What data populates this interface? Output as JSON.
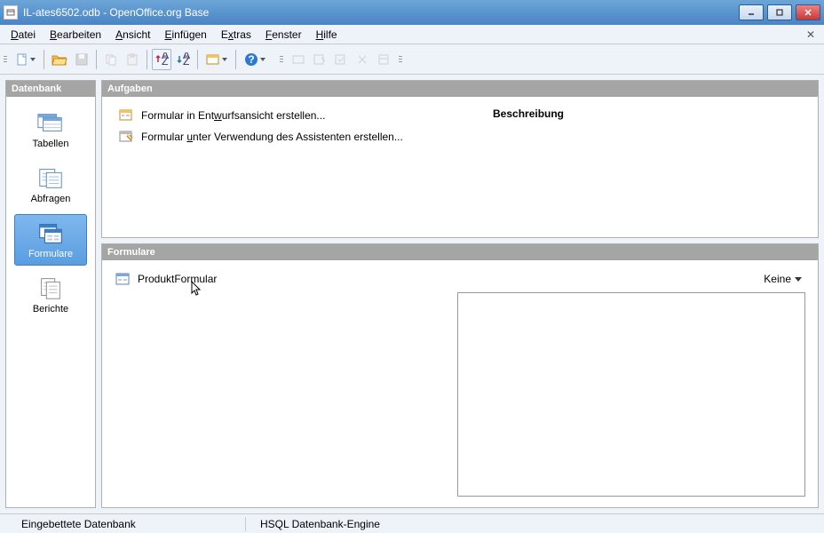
{
  "window": {
    "title": "IL-ates6502.odb - OpenOffice.org Base"
  },
  "menus": {
    "file": "Datei",
    "edit": "Bearbeiten",
    "view": "Ansicht",
    "insert": "Einfügen",
    "tools": "Extras",
    "window": "Fenster",
    "help": "Hilfe"
  },
  "sidebar": {
    "header": "Datenbank",
    "items": [
      {
        "label": "Tabellen"
      },
      {
        "label": "Abfragen"
      },
      {
        "label": "Formulare"
      },
      {
        "label": "Berichte"
      }
    ]
  },
  "tasks": {
    "header": "Aufgaben",
    "task1_pre": "Formular in Ent",
    "task1_u": "w",
    "task1_post": "urfsansicht erstellen...",
    "task2_pre": "Formular ",
    "task2_u": "u",
    "task2_post": "nter Verwendung des Assistenten erstellen...",
    "desc_label": "Beschreibung"
  },
  "items": {
    "header": "Formulare",
    "form1": "ProduktFormular",
    "preview_mode": "Keine"
  },
  "status": {
    "embedded": "Eingebettete Datenbank",
    "engine": "HSQL Datenbank-Engine"
  }
}
